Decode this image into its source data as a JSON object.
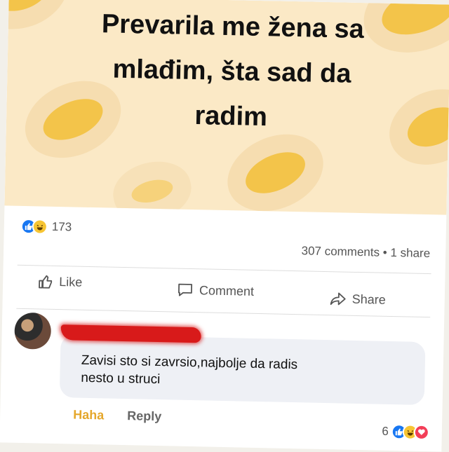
{
  "post": {
    "title_lines": [
      "Prevarila me žena sa",
      "mlađim, šta sad da",
      "radim"
    ],
    "bg_color": "#fbe9c6",
    "blob_color": "#f3c44a"
  },
  "stats": {
    "reaction_count": "173",
    "comments_share": "307 comments • 1 share",
    "reaction_icons": [
      "like-icon",
      "haha-icon"
    ]
  },
  "actions": {
    "like_label": "Like",
    "comment_label": "Comment",
    "share_label": "Share"
  },
  "comment": {
    "author_redacted": true,
    "text_line1": "Zavisi sto si zavrsio,najbolje da radis",
    "text_line2": "nesto u struci",
    "haha_label": "Haha",
    "reply_label": "Reply",
    "reaction_count": "6",
    "reaction_icons": [
      "like-icon",
      "haha-icon",
      "love-icon"
    ]
  },
  "colors": {
    "facebook_blue": "#1877f2",
    "haha_yellow": "#f7c533",
    "love_red": "#f33e58",
    "redaction_red": "#d81a1a"
  }
}
